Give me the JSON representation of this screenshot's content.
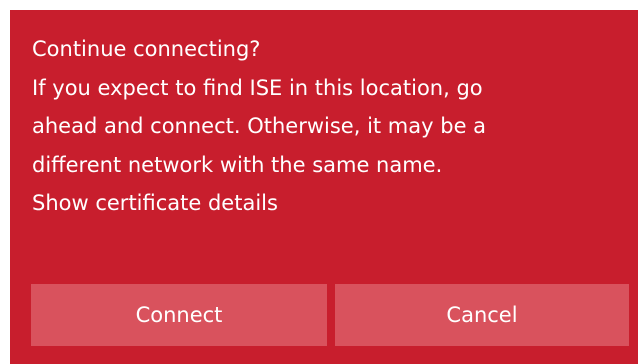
{
  "dialog": {
    "title": "Continue connecting?",
    "message_lines": [
      "If you expect to find ISE in this location, go",
      "ahead and connect. Otherwise, it may be a",
      "different network with the same name."
    ],
    "certificate_link": "Show certificate details",
    "connect_label": "Connect",
    "cancel_label": "Cancel",
    "colors": {
      "background": "#c81e2d",
      "button": "#d9525d",
      "text": "#ffffff"
    }
  }
}
